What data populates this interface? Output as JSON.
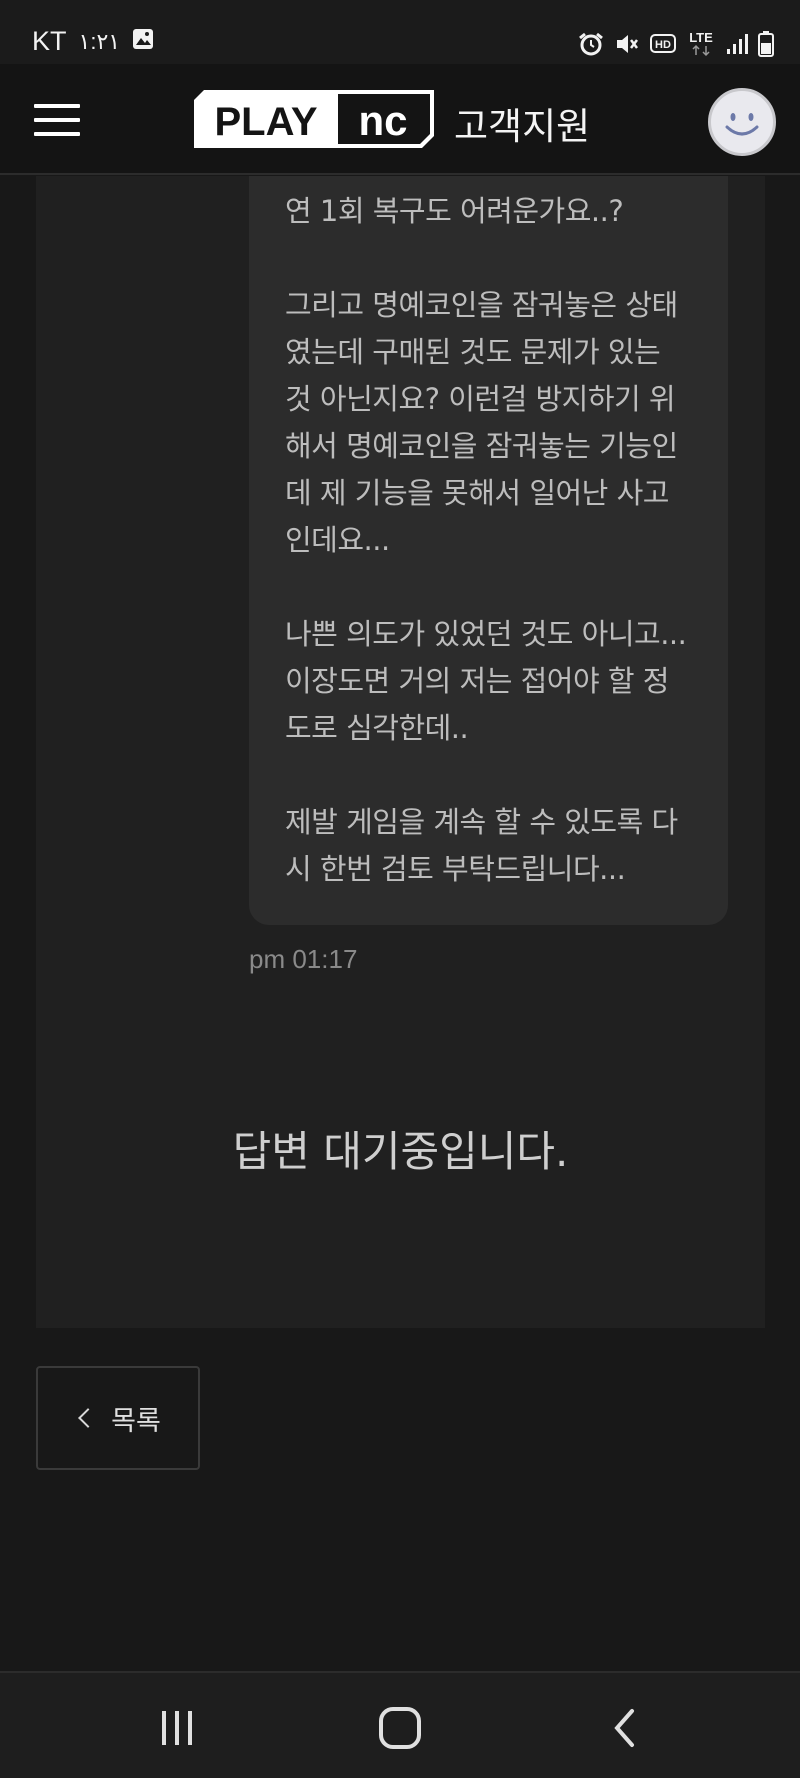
{
  "status_bar": {
    "carrier": "KT",
    "time": "١:٢١",
    "icons": [
      "image-icon",
      "alarm-icon",
      "mute-icon",
      "hd-icon",
      "lte-icon",
      "signal-icon",
      "battery-icon"
    ],
    "hd_label": "HD",
    "lte_label": "LTE"
  },
  "header": {
    "logo_text_play": "PLAY",
    "logo_text_nc": "nc",
    "title": "고객지원"
  },
  "message": {
    "paragraphs": [
      "연 1회 복구도 어려운가요..?",
      "그리고 명예코인을 잠궈놓은 상태였는데 구매된 것도 문제가 있는 것 아닌지요? 이런걸 방지하기 위해서 명예코인을 잠궈놓는 기능인데 제 기능을 못해서 일어난 사고 인데요...",
      "나쁜 의도가 있었던 것도 아니고... 이장도면 거의 저는 접어야 할 정도로 심각한데..",
      "제발 게임을 계속 할 수 있도록 다시 한번 검토 부탁드립니다..."
    ],
    "time": "pm 01:17"
  },
  "waiting_text": "답변 대기중입니다.",
  "list_button_label": "목록",
  "colors": {
    "background": "#181818",
    "panel": "#202020",
    "bubble": "#2c2c2c",
    "text": "#bdbdbd"
  }
}
